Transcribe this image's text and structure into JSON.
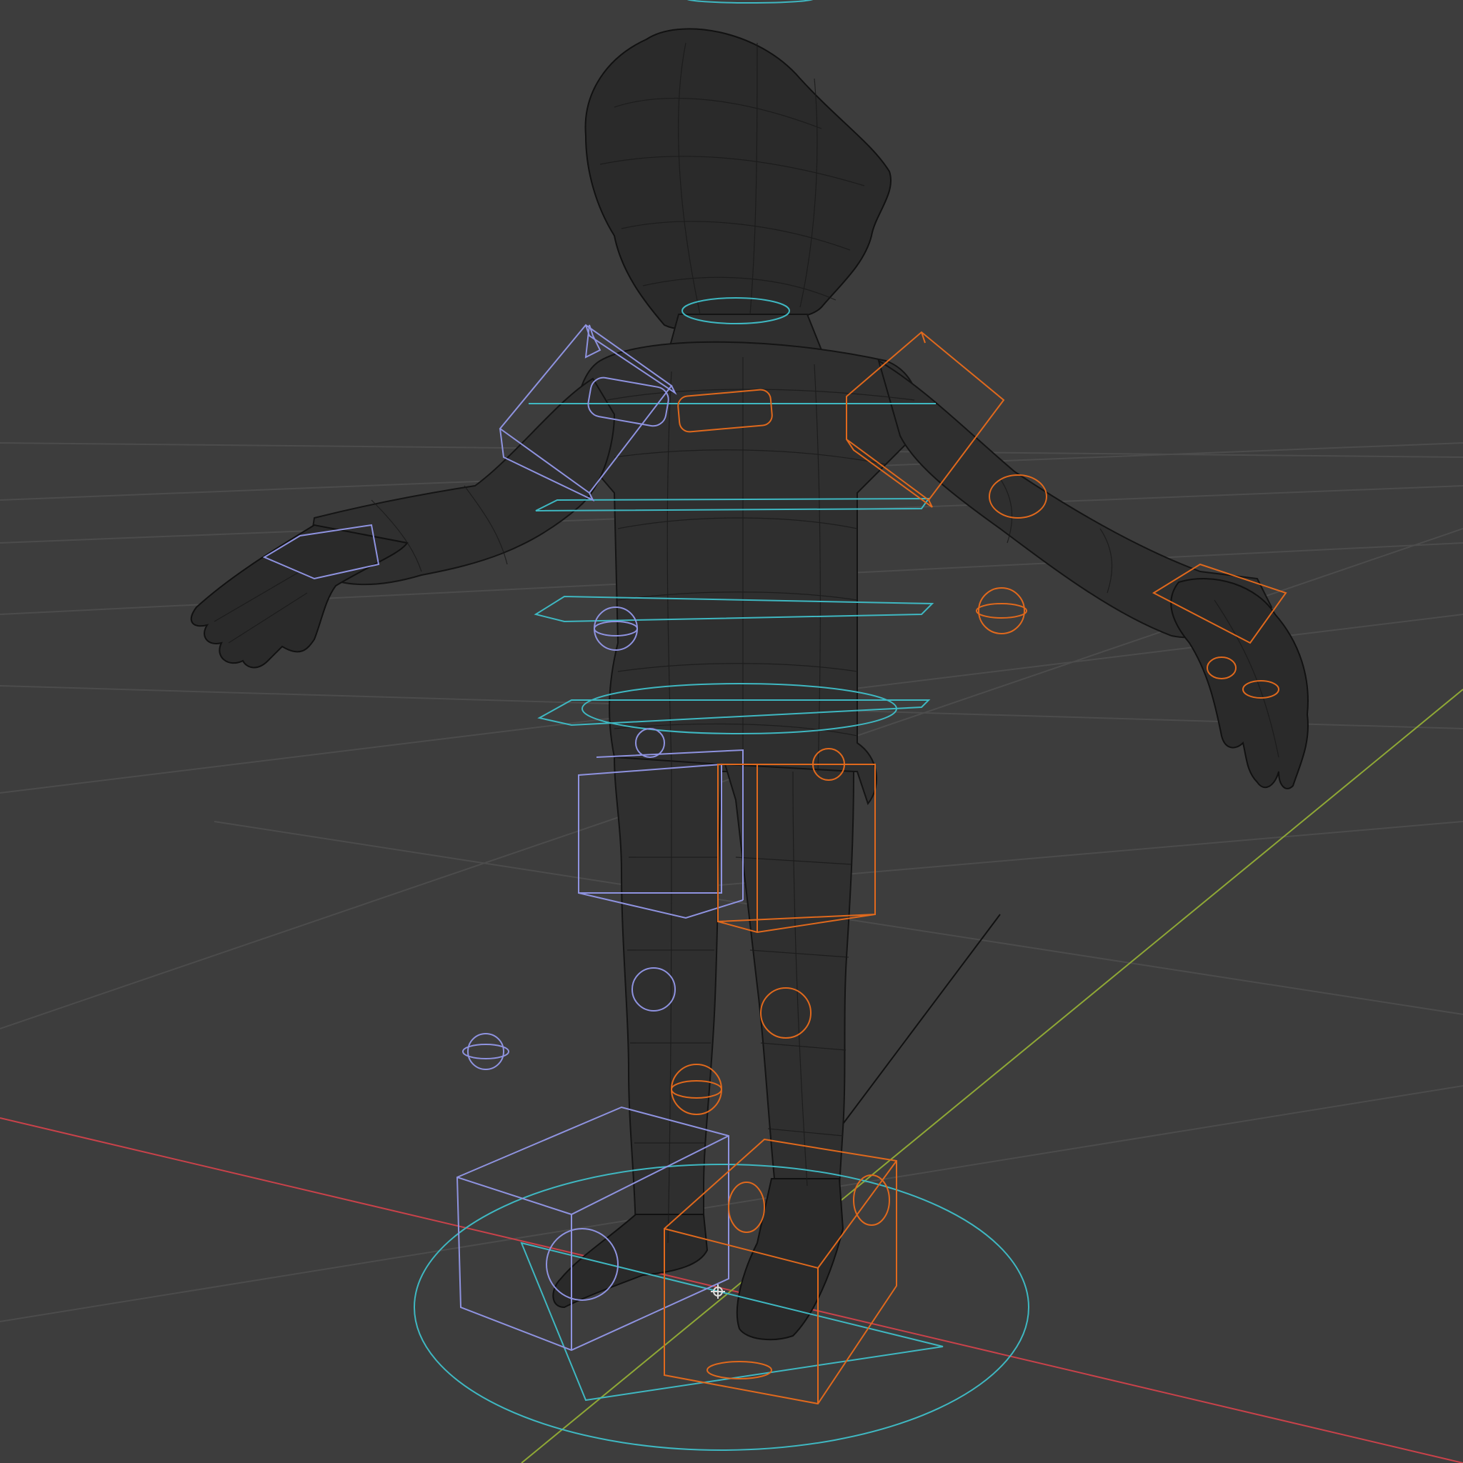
{
  "viewport": {
    "background_color": "#3d3d3d",
    "grid_color": "#4c4c4c",
    "x_axis_color": "#c9424a",
    "y_axis_color": "#8fa836",
    "mesh_wire_color": "#141414"
  },
  "rig": {
    "left_controls_color": "#8f93e0",
    "right_controls_color": "#e0691d",
    "center_controls_color": "#3fb8c2"
  },
  "icons": [
    "origin-marker-icon",
    "bone-sphere-icon",
    "bone-cube-icon",
    "bone-circle-icon"
  ]
}
